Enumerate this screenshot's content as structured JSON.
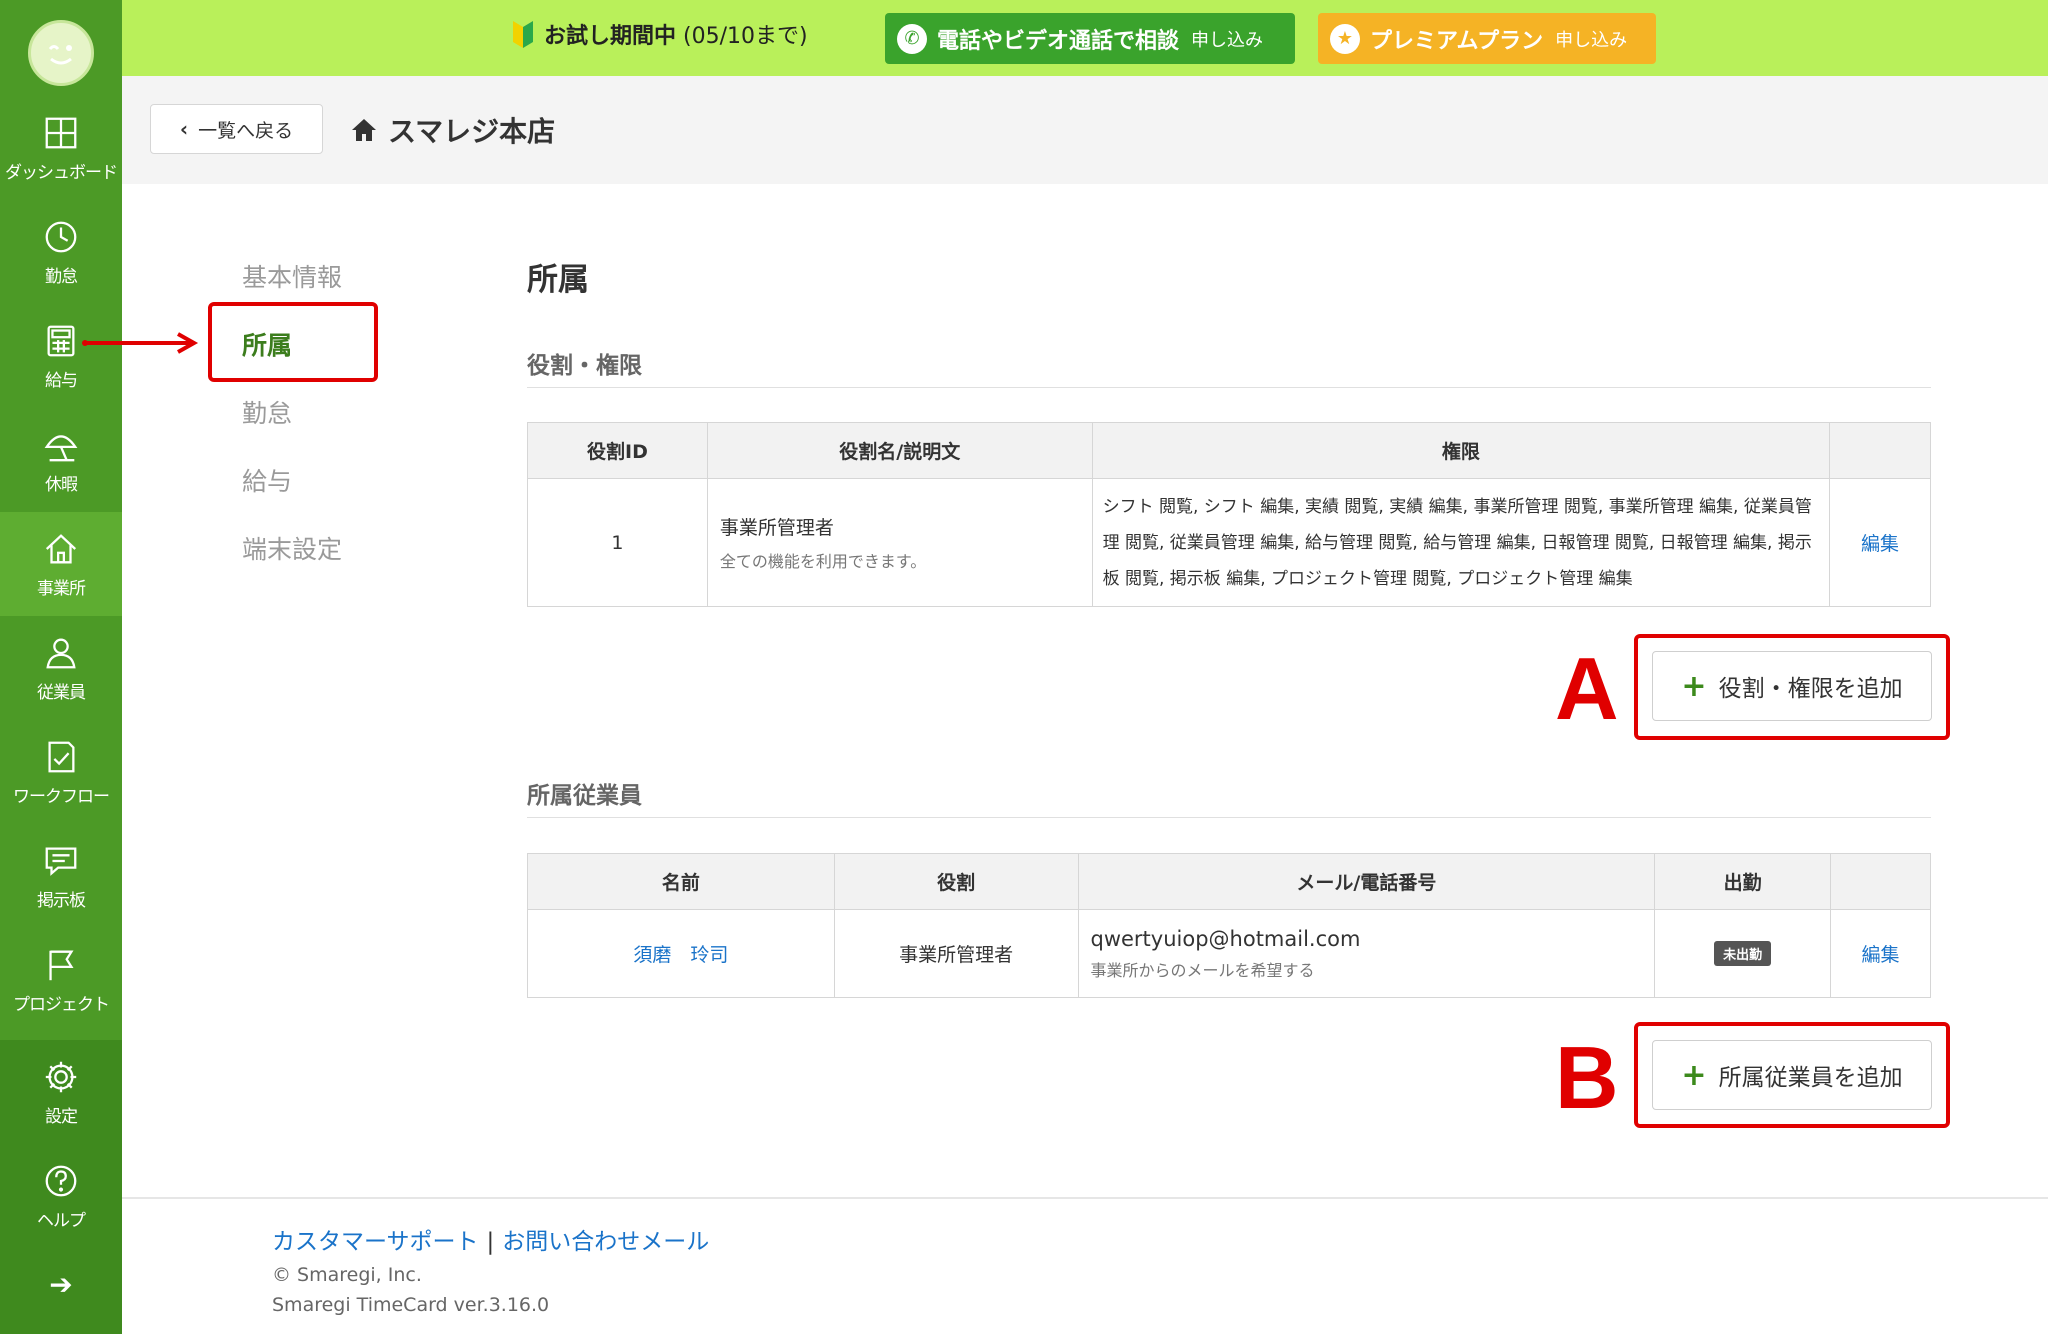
{
  "sidebar": {
    "items": [
      {
        "label": "ダッシュボード",
        "icon": "dashboard-icon"
      },
      {
        "label": "勤怠",
        "icon": "clock-icon"
      },
      {
        "label": "給与",
        "icon": "calculator-icon"
      },
      {
        "label": "休暇",
        "icon": "umbrella-icon"
      },
      {
        "label": "事業所",
        "icon": "home-icon"
      },
      {
        "label": "従業員",
        "icon": "user-icon"
      },
      {
        "label": "ワークフロー",
        "icon": "workflow-icon"
      },
      {
        "label": "掲示板",
        "icon": "message-icon"
      },
      {
        "label": "プロジェクト",
        "icon": "flag-icon"
      },
      {
        "label": "設定",
        "icon": "gear-icon"
      },
      {
        "label": "ヘルプ",
        "icon": "help-icon"
      }
    ],
    "collapse_glyph": "➔"
  },
  "banner": {
    "trial_label": "お試し期間中",
    "trial_until": "(05/10まで)",
    "consult_label": "電話やビデオ通話で相談",
    "consult_apply": "申し込み",
    "premium_label": "プレミアムプラン",
    "premium_apply": "申し込み"
  },
  "header": {
    "back_label": "一覧へ戻る",
    "store_name": "スマレジ本店"
  },
  "subnav": {
    "items": [
      "基本情報",
      "所属",
      "勤怠",
      "給与",
      "端末設定"
    ],
    "active": "所属"
  },
  "main": {
    "title": "所属",
    "roles_heading": "役割・権限",
    "roles_table": {
      "headers": [
        "役割ID",
        "役割名/説明文",
        "権限",
        ""
      ],
      "rows": [
        {
          "id": "1",
          "name": "事業所管理者",
          "description": "全ての機能を利用できます。",
          "permissions": "シフト 閲覧, シフト 編集, 実績 閲覧, 実績 編集, 事業所管理 閲覧, 事業所管理 編集, 従業員管理 閲覧, 従業員管理 編集, 給与管理 閲覧, 給与管理 編集, 日報管理 閲覧, 日報管理 編集, 掲示板 閲覧, 掲示板 編集, プロジェクト管理 閲覧, プロジェクト管理 編集",
          "edit": "編集"
        }
      ]
    },
    "add_role_label": "役割・権限を追加",
    "staff_heading": "所属従業員",
    "staff_table": {
      "headers": [
        "名前",
        "役割",
        "メール/電話番号",
        "出勤",
        ""
      ],
      "rows": [
        {
          "name": "須磨　玲司",
          "role": "事業所管理者",
          "email": "qwertyuiop@hotmail.com",
          "email_note": "事業所からのメールを希望する",
          "status": "未出勤",
          "edit": "編集"
        }
      ]
    },
    "add_staff_label": "所属従業員を追加",
    "annotation_a": "A",
    "annotation_b": "B"
  },
  "footer": {
    "support_link": "カスタマーサポート",
    "separator": "|",
    "contact_link": "お問い合わせメール",
    "copyright": "© Smaregi, Inc.",
    "version": "Smaregi TimeCard ver.3.16.0"
  },
  "colors": {
    "sidebar": "#4c9a26",
    "banner": "#b9f05a",
    "consult": "#3aa32c",
    "premium": "#f5b325",
    "annotation": "#e00000",
    "link": "#1a73c9"
  }
}
